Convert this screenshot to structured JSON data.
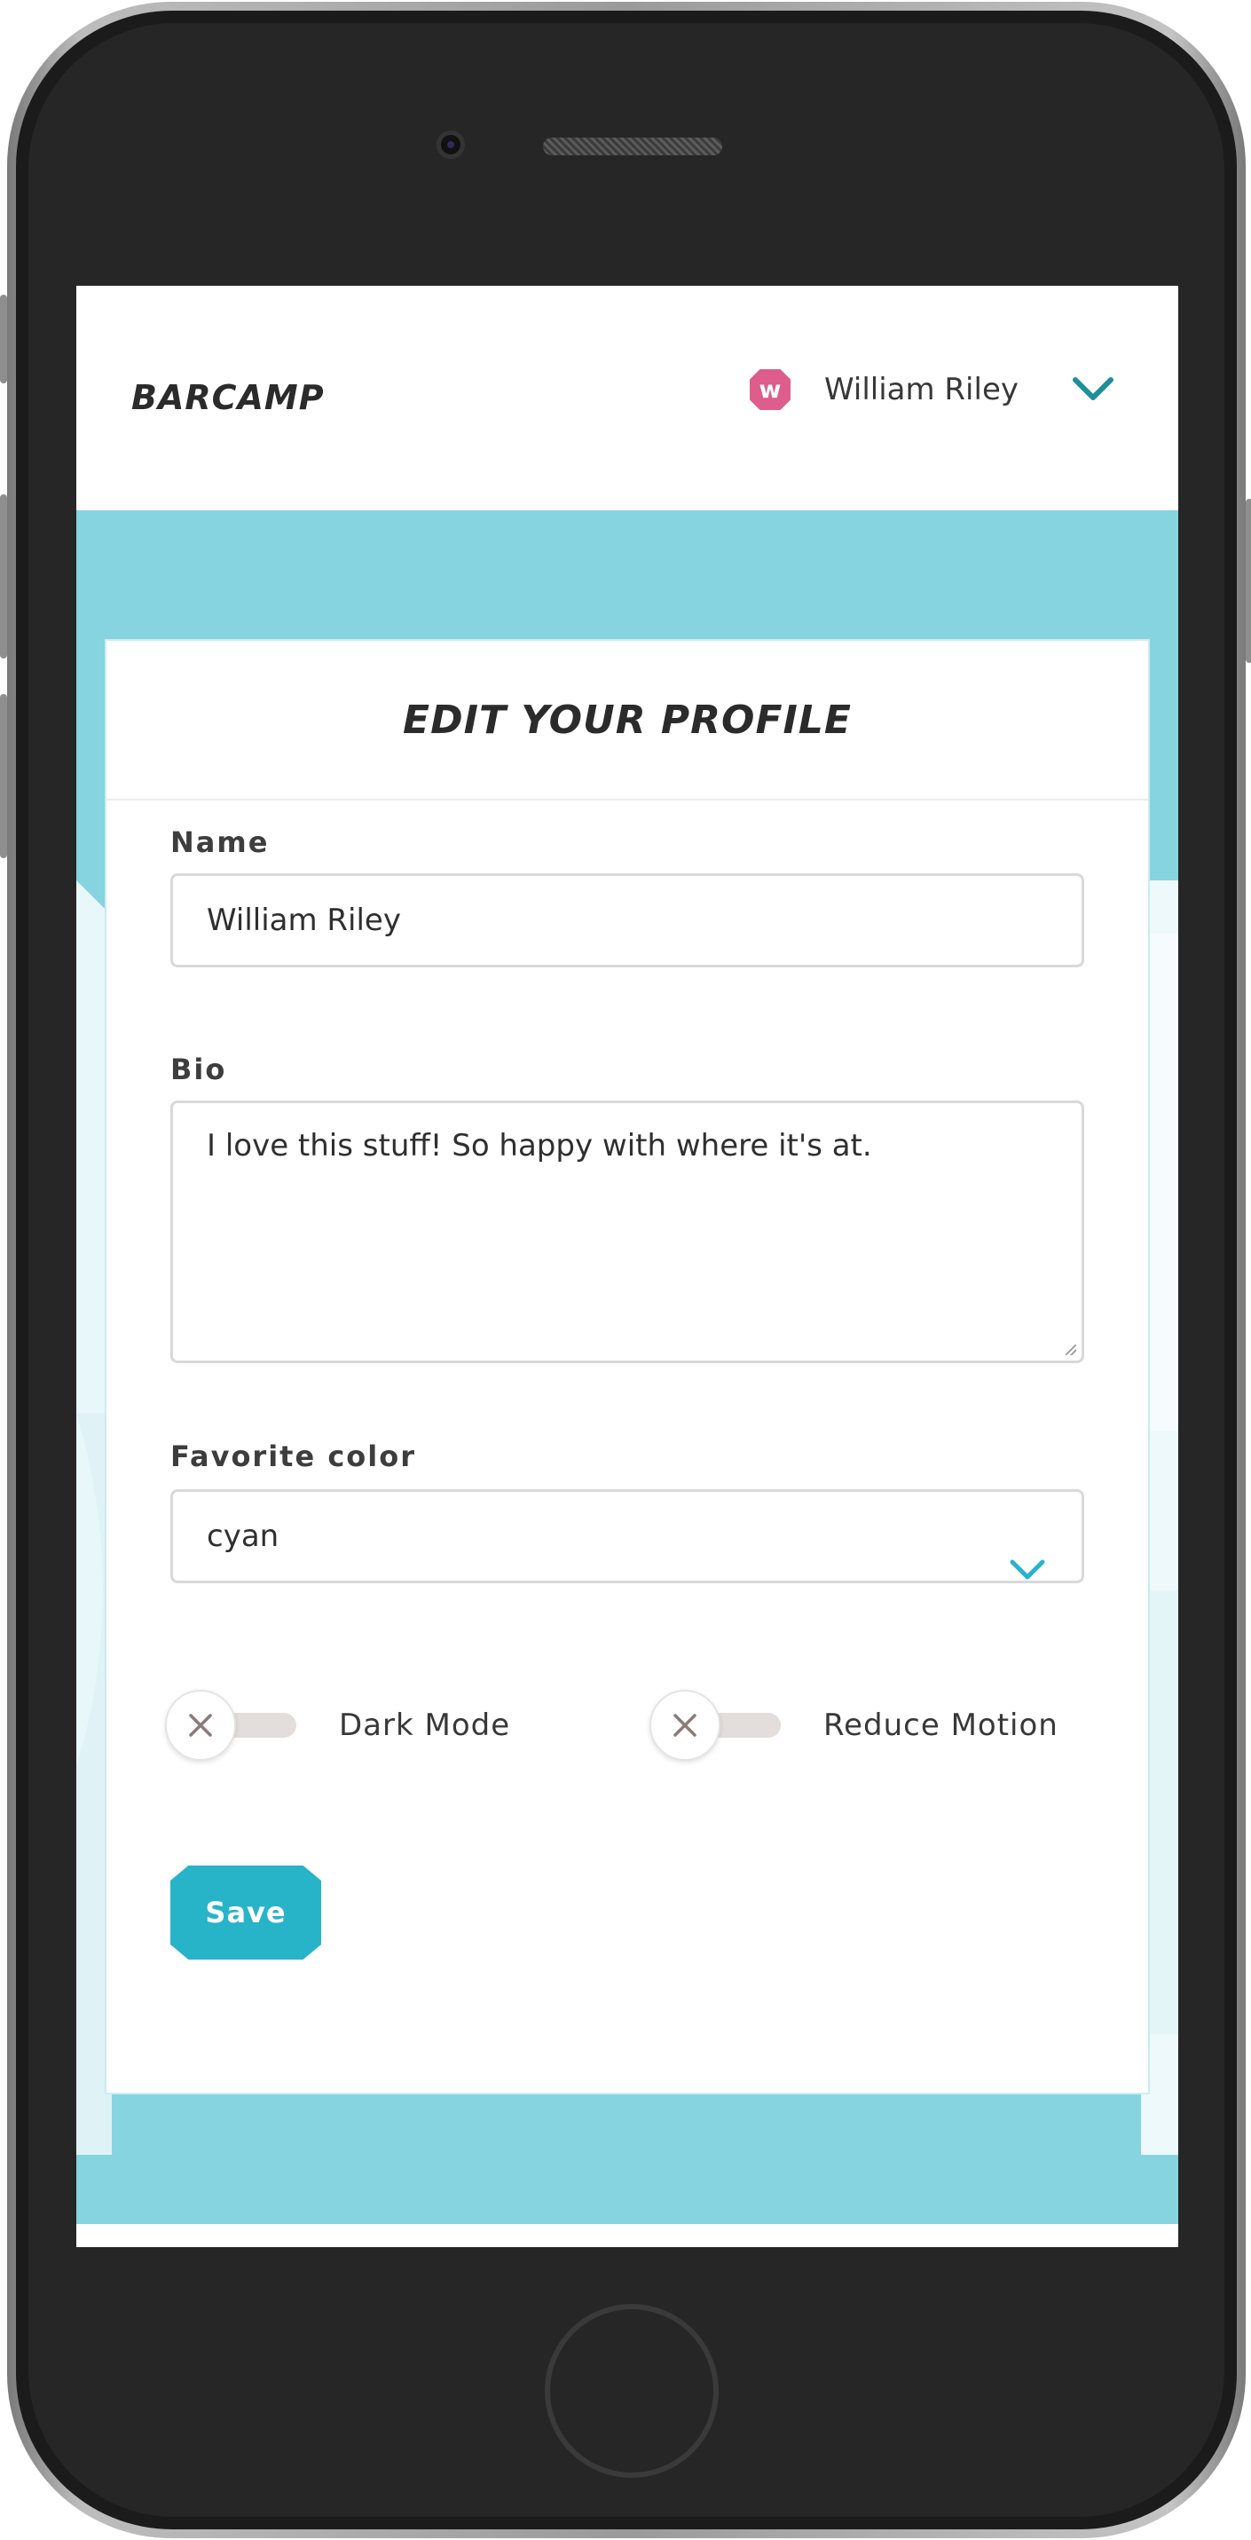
{
  "app": {
    "logo": "BARCAMP"
  },
  "user_menu": {
    "avatar_initial": "w",
    "name": "William Riley",
    "avatar_color": "#dd5d8b"
  },
  "card": {
    "title": "EDIT YOUR PROFILE"
  },
  "form": {
    "name_label": "Name",
    "name_value": "William Riley",
    "bio_label": "Bio",
    "bio_value": "I love this stuff! So happy with where it's at.",
    "color_label": "Favorite color",
    "color_value": "cyan",
    "toggles": [
      {
        "label": "Dark Mode",
        "on": false
      },
      {
        "label": "Reduce Motion",
        "on": false
      }
    ],
    "save_label": "Save"
  },
  "colors": {
    "accent": "#27b4c9",
    "screen_background": "#85d4df",
    "chevron": "#1f8f9c"
  },
  "icons": {
    "user_menu_chevron": "chevron-down-icon",
    "select_chevron": "chevron-down-icon",
    "toggle_off": "close-icon"
  }
}
